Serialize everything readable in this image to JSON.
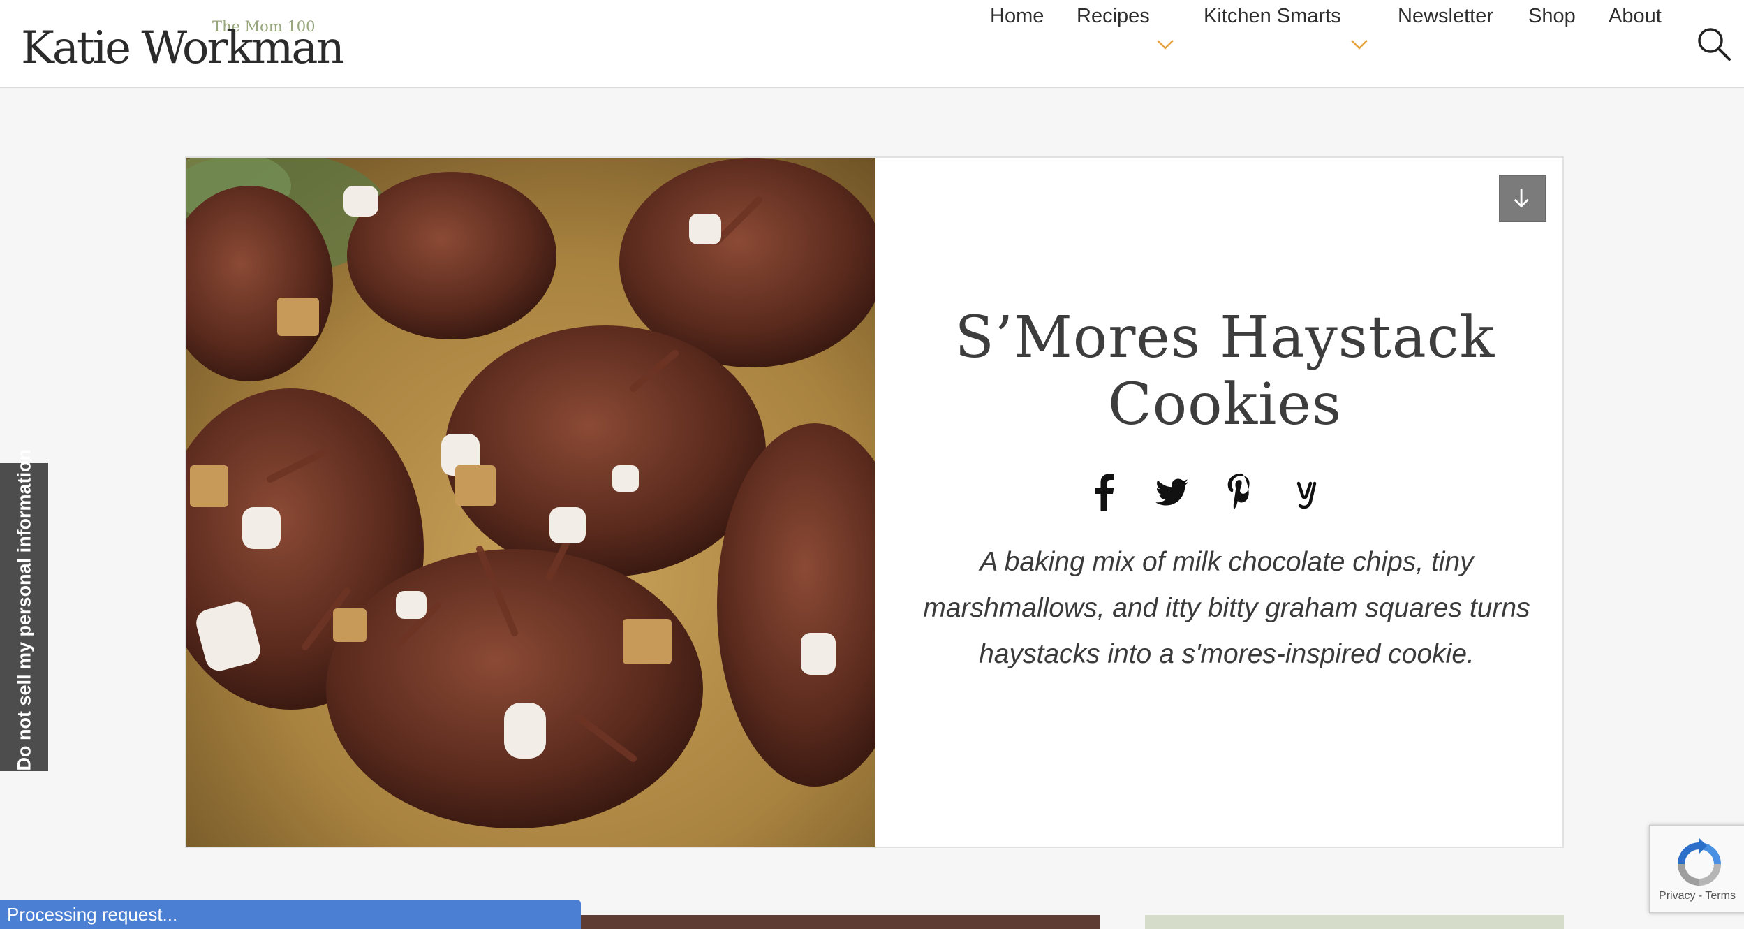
{
  "header": {
    "logo_main": "Katie Workman",
    "logo_sub": "The Mom 100",
    "nav": {
      "home": "Home",
      "recipes": "Recipes",
      "kitchen_smarts": "Kitchen Smarts",
      "newsletter": "Newsletter",
      "shop": "Shop",
      "about": "About"
    }
  },
  "recipe": {
    "title_line1": "S’Mores Haystack",
    "title_line2": "Cookies",
    "description": "A baking mix of milk chocolate chips, tiny marshmallows, and itty bitty graham squares turns haystacks into a s'mores-inspired cookie.",
    "share_icons": [
      "facebook-icon",
      "twitter-icon",
      "pinterest-icon",
      "yummly-icon"
    ]
  },
  "privacy_tab": "Do not sell my personal information",
  "status": "Processing request...",
  "recaptcha": {
    "privacy": "Privacy",
    "separator": " - ",
    "terms": "Terms"
  },
  "colors": {
    "accent_chevron": "#e8a23c",
    "logo_sub": "#97a67c",
    "processing_bar": "#4a7fd3"
  }
}
